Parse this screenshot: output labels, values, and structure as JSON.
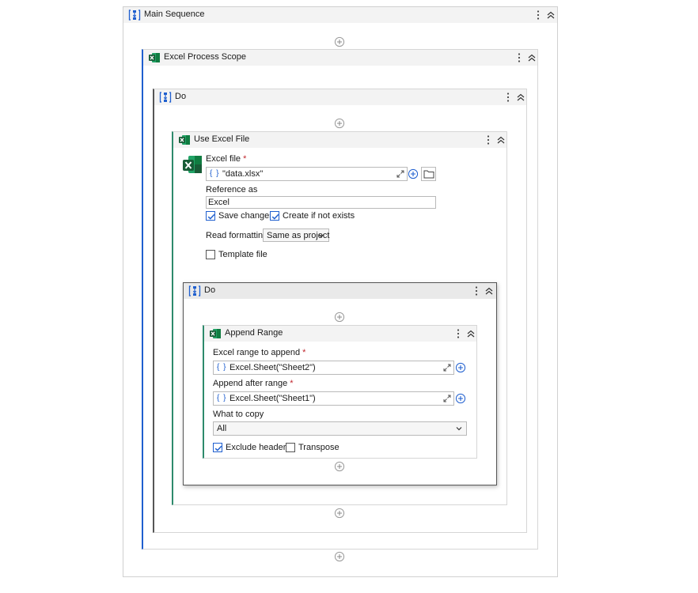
{
  "main_sequence": {
    "title": "Main Sequence"
  },
  "excel_process_scope": {
    "title": "Excel Process Scope"
  },
  "do_outer": {
    "title": "Do"
  },
  "use_excel_file": {
    "title": "Use Excel File",
    "excel_file_label": "Excel file",
    "required_mark": "*",
    "excel_file_value": "\"data.xlsx\"",
    "reference_as_label": "Reference as",
    "reference_as_value": "Excel",
    "save_changes_label": "Save changes",
    "save_changes_checked": true,
    "create_if_not_exists_label": "Create if not exists",
    "create_if_not_exists_checked": true,
    "read_formatting_label": "Read formatting",
    "read_formatting_value": "Same as project",
    "template_file_label": "Template file",
    "template_file_checked": false
  },
  "do_inner": {
    "title": "Do"
  },
  "append_range": {
    "title": "Append Range",
    "range_to_append_label": "Excel range to append",
    "range_to_append_value": "Excel.Sheet(\"Sheet2\")",
    "append_after_label": "Append after range",
    "append_after_value": "Excel.Sheet(\"Sheet1\")",
    "what_to_copy_label": "What to copy",
    "what_to_copy_value": "All",
    "exclude_headers_label": "Exclude headers",
    "exclude_headers_checked": true,
    "transpose_label": "Transpose",
    "transpose_checked": false
  },
  "expression_brace": "{ }",
  "icons": {
    "sequence": "sequence-icon",
    "excel": "excel-icon",
    "kebab": "kebab-menu-icon",
    "collapse": "collapse-chevron-icon",
    "add": "add-activity-icon",
    "expand": "expand-editor-icon",
    "folder": "folder-icon"
  },
  "colors": {
    "accent_blue": "#1f5fcf",
    "excel_green": "#1d6f42",
    "accent_green": "#2e8a6c"
  }
}
